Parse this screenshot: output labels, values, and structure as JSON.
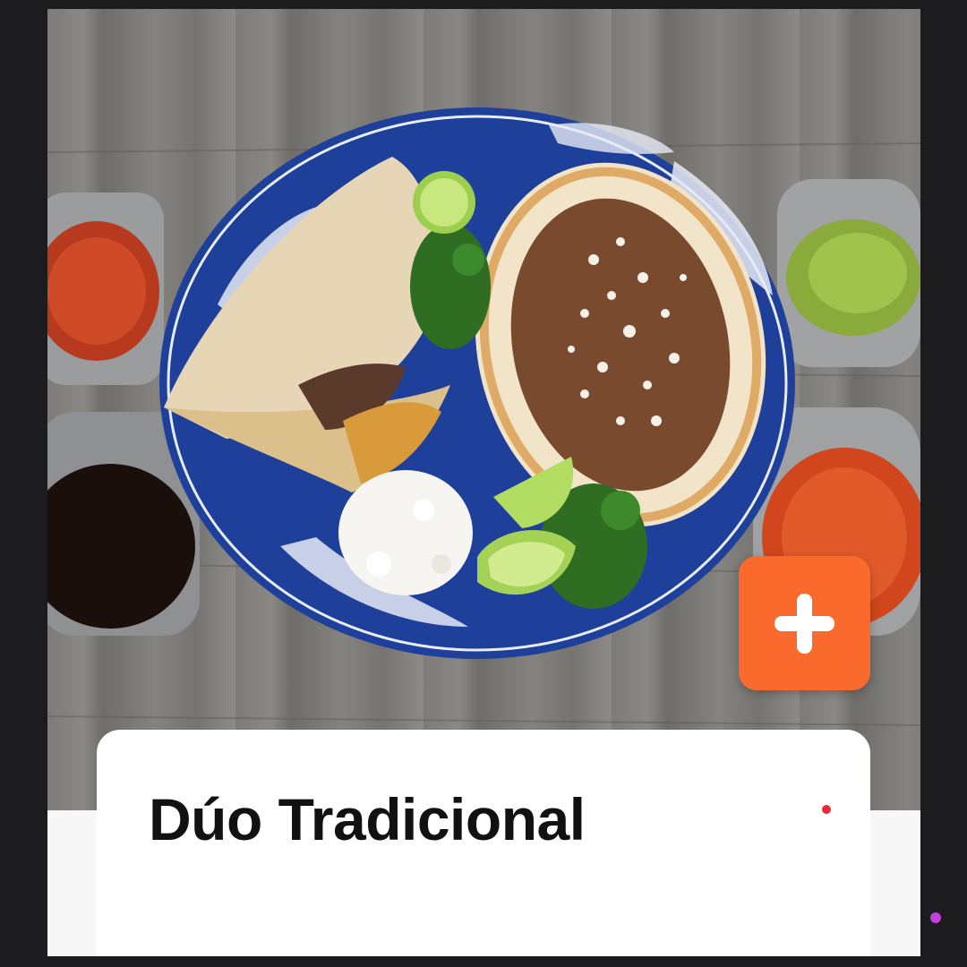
{
  "product": {
    "title": "Dúo Tradicional",
    "image_subject": "tacos-plate",
    "add_button_icon": "plus-icon"
  },
  "colors": {
    "accent": "#fa6a2d",
    "plate_blue": "#1e3f9a",
    "notification_dot": "#e8283a",
    "edge_dot": "#c43ee0"
  }
}
